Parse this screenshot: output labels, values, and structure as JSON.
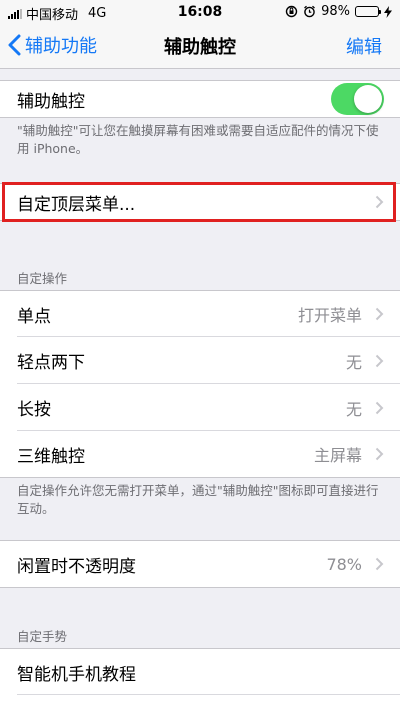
{
  "status_bar": {
    "carrier": "中国移动",
    "network": "4G",
    "time": "16:08",
    "battery": "98%",
    "battery_level": 0.98
  },
  "nav": {
    "back_label": "辅助功能",
    "title": "辅助触控",
    "edit_label": "编辑"
  },
  "assistive_touch": {
    "label": "辅助触控",
    "enabled": true,
    "footer": "\"辅助触控\"可让您在触摸屏幕有困难或需要自适应配件的情况下使用 iPhone。"
  },
  "top_menu": {
    "label": "自定顶层菜单..."
  },
  "custom_actions": {
    "header": "自定操作",
    "rows": [
      {
        "label": "单点",
        "value": "打开菜单"
      },
      {
        "label": "轻点两下",
        "value": "无"
      },
      {
        "label": "长按",
        "value": "无"
      },
      {
        "label": "三维触控",
        "value": "主屏幕"
      }
    ],
    "footer": "自定操作允许您无需打开菜单，通过\"辅助触控\"图标即可直接进行互动。"
  },
  "idle_opacity": {
    "label": "闲置时不透明度",
    "value": "78%"
  },
  "custom_gestures": {
    "header": "自定手势",
    "rows": [
      {
        "label": "智能机手机教程"
      }
    ]
  },
  "colors": {
    "accent": "#1478f6",
    "toggle_on": "#4cd964",
    "highlight": "#e02020"
  }
}
